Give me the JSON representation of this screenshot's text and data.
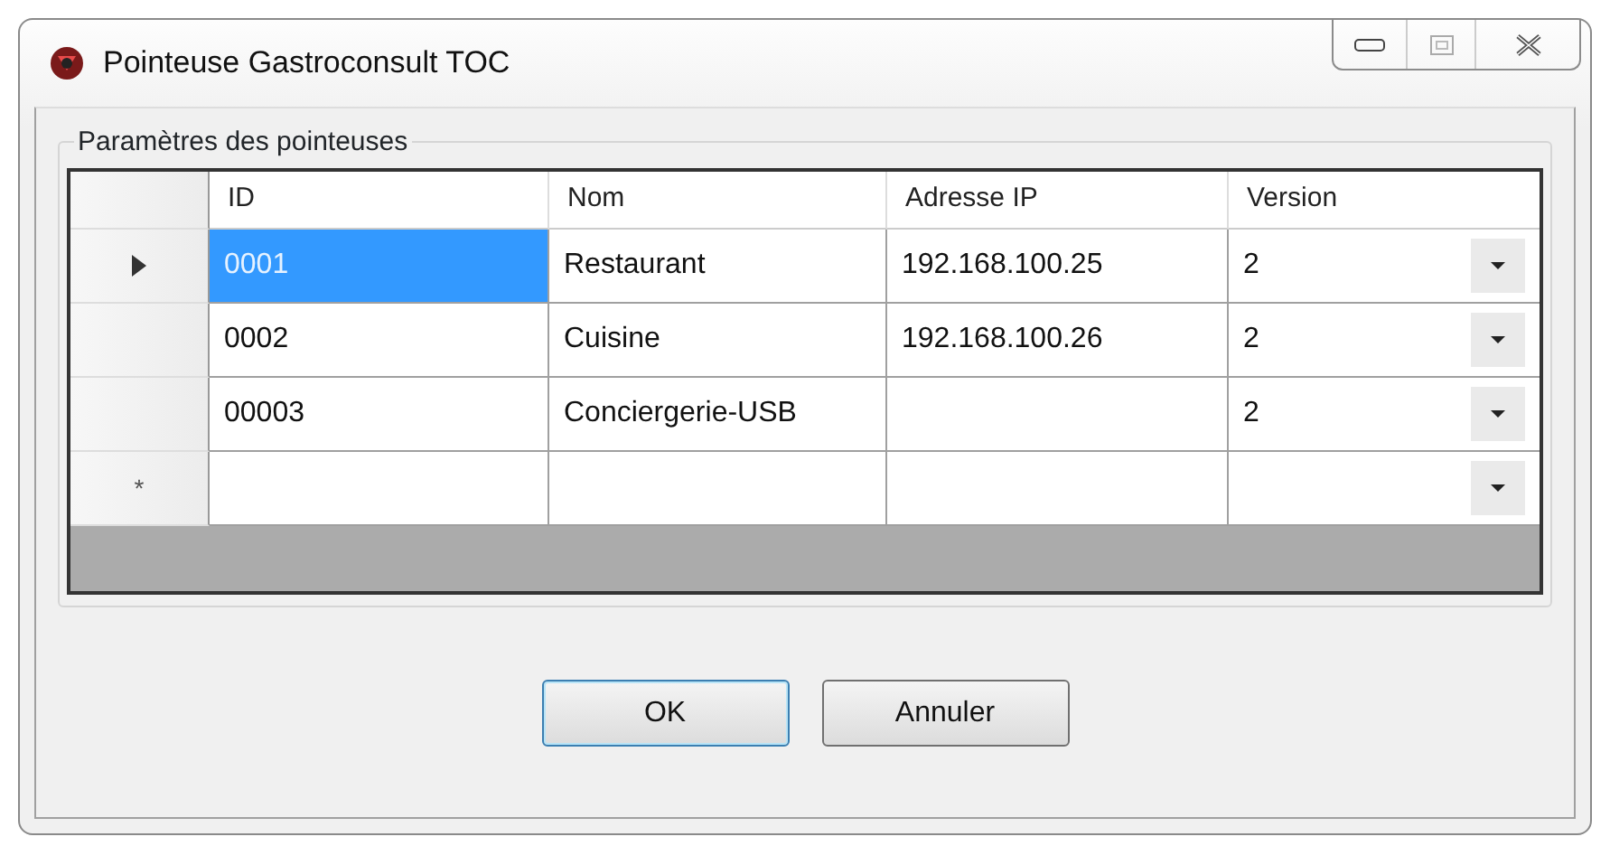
{
  "window": {
    "title": "Pointeuse Gastroconsult TOC"
  },
  "group": {
    "title": "Paramètres des pointeuses"
  },
  "table": {
    "columns": [
      "ID",
      "Nom",
      "Adresse IP",
      "Version"
    ],
    "rows": [
      {
        "kind": "data",
        "selected": true,
        "cells": [
          "0001",
          "Restaurant",
          "192.168.100.25",
          "2"
        ]
      },
      {
        "kind": "data",
        "selected": false,
        "cells": [
          "0002",
          "Cuisine",
          "192.168.100.26",
          "2"
        ]
      },
      {
        "kind": "data",
        "selected": false,
        "cells": [
          "00003",
          "Conciergerie-USB",
          "",
          "2"
        ]
      },
      {
        "kind": "new",
        "selected": false,
        "marker": "*",
        "cells": [
          "",
          "",
          "",
          ""
        ]
      }
    ]
  },
  "buttons": [
    {
      "label": "OK",
      "default": true
    },
    {
      "label": "Annuler",
      "default": false
    }
  ]
}
